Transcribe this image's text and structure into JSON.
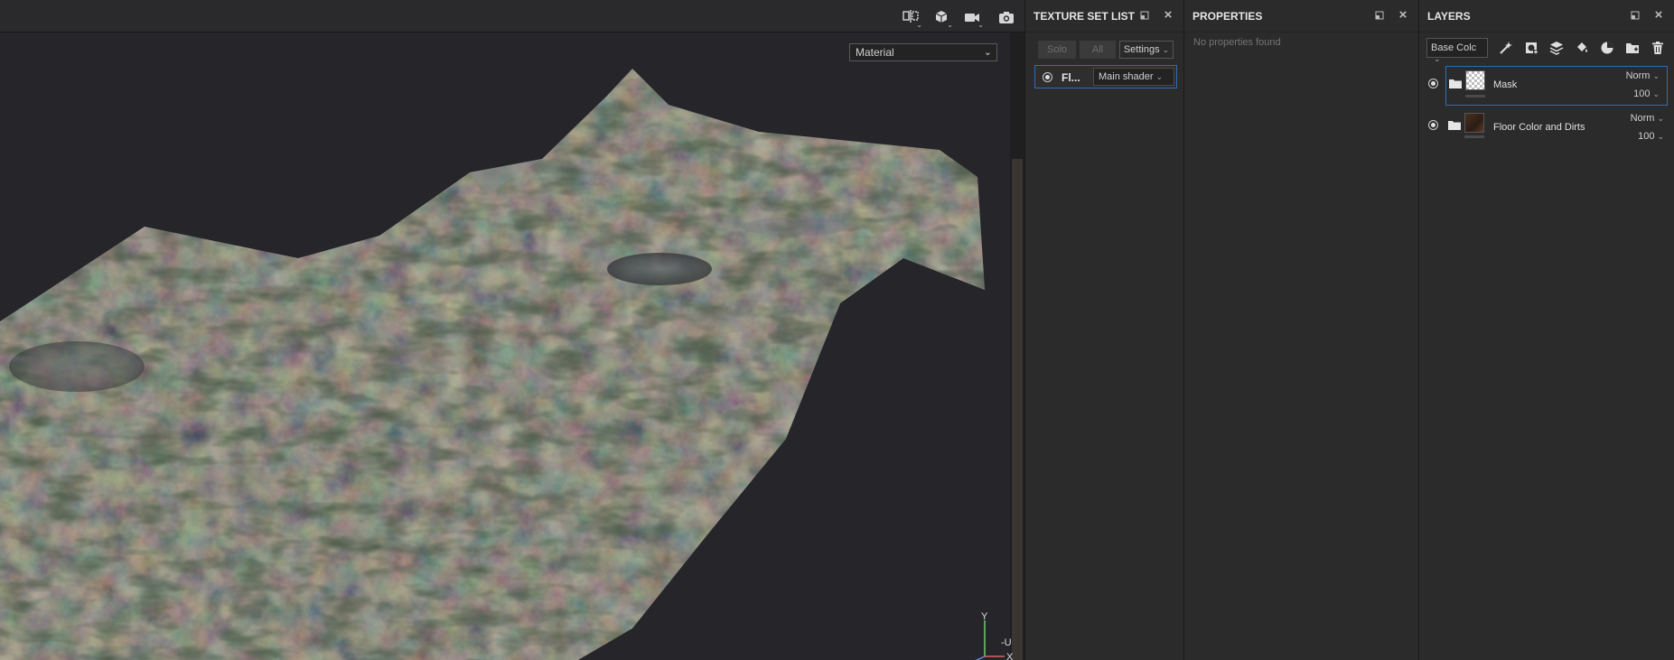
{
  "viewport": {
    "material_select": "Material",
    "axis_labels": {
      "y": "Y",
      "x": "X",
      "u": "-U"
    },
    "toolbar_icons": [
      "split-view-icon",
      "cube-view-icon",
      "camera-icon",
      "screenshot-icon"
    ]
  },
  "texture_set_list": {
    "title": "TEXTURE SET LIST",
    "solo_label": "Solo",
    "all_label": "All",
    "settings_label": "Settings",
    "row": {
      "name": "Fl...",
      "shader": "Main shader"
    }
  },
  "properties": {
    "title": "PROPERTIES",
    "empty_text": "No properties found"
  },
  "layers": {
    "title": "LAYERS",
    "channel": "Base Colc",
    "items": [
      {
        "name": "Mask",
        "blend": "Norm",
        "opacity": "100"
      },
      {
        "name": "Floor Color and Dirts",
        "blend": "Norm",
        "opacity": "100"
      }
    ]
  },
  "colors": {
    "accent": "#2d6db3",
    "panel_bg": "#2b2b2b",
    "viewport_bg": "#25252a"
  }
}
